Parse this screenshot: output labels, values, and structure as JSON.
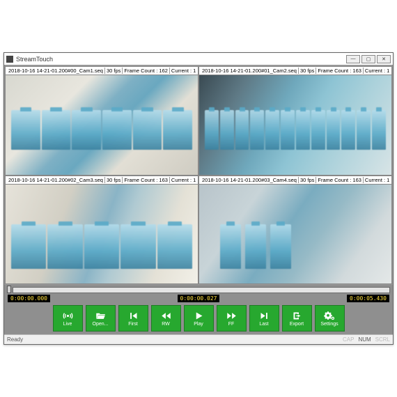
{
  "window": {
    "title": "StreamTouch",
    "minimize": "—",
    "maximize": "▢",
    "close": "✕"
  },
  "cams": [
    {
      "file": "2018-10-16 14-21-01.200#00_Cam1.seq",
      "fps": "30 fps",
      "frames": "Frame Count : 162",
      "current": "Current : 1"
    },
    {
      "file": "2018-10-16 14-21-01.200#01_Cam2.seq",
      "fps": "30 fps",
      "frames": "Frame Count : 163",
      "current": "Current : 1"
    },
    {
      "file": "2018-10-16 14-21-01.200#02_Cam3.seq",
      "fps": "30 fps",
      "frames": "Frame Count : 163",
      "current": "Current : 1"
    },
    {
      "file": "2018-10-16 14-21-01.200#03_Cam4.seq",
      "fps": "30 fps",
      "frames": "Frame Count : 163",
      "current": "Current : 1"
    }
  ],
  "timeline": {
    "start": "0:00:00.000",
    "current": "0:00:00.027",
    "end": "0:00:05.430"
  },
  "buttons": {
    "live": "Live",
    "open": "Open...",
    "first": "First",
    "rw": "RW",
    "play": "Play",
    "ff": "FF",
    "last": "Last",
    "export": "Export",
    "settings": "Settings"
  },
  "status": {
    "ready": "Ready",
    "cap": "CAP",
    "num": "NUM",
    "scrl": "SCRL"
  }
}
